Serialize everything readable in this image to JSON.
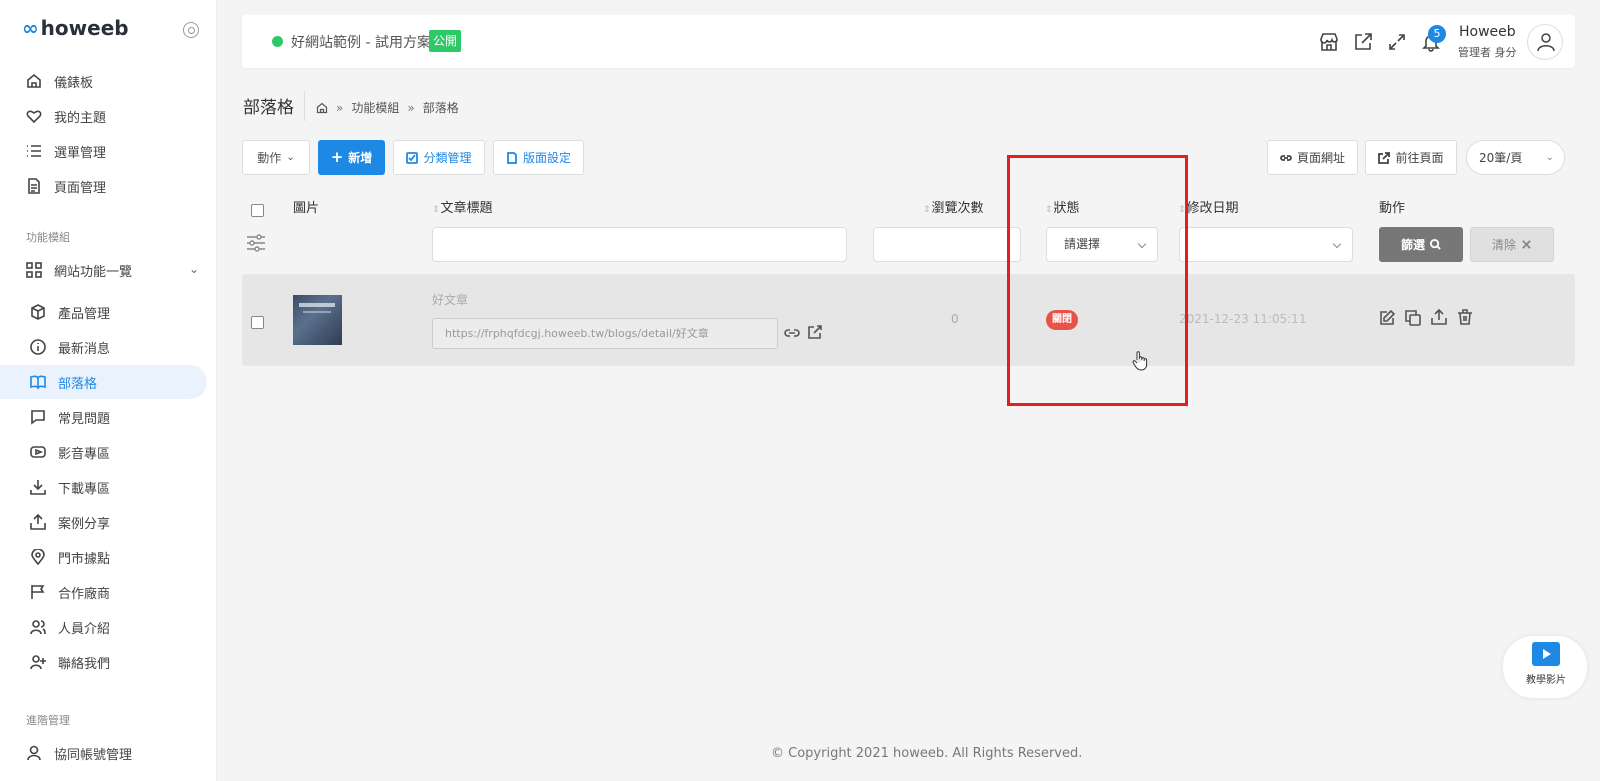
{
  "brand": {
    "logo_mark": "∞",
    "logo_text": "howeeb"
  },
  "sidebar": {
    "items": [
      {
        "label": "儀錶板",
        "icon": "home-icon"
      },
      {
        "label": "我的主題",
        "icon": "heart-icon"
      },
      {
        "label": "選單管理",
        "icon": "list-icon"
      },
      {
        "label": "頁面管理",
        "icon": "file-icon"
      }
    ],
    "section_modules": "功能模組",
    "group_label": "網站功能一覽",
    "sub_items": [
      {
        "label": "產品管理",
        "icon": "box-icon"
      },
      {
        "label": "最新消息",
        "icon": "info-icon"
      },
      {
        "label": "部落格",
        "icon": "book-icon",
        "active": true
      },
      {
        "label": "常見問題",
        "icon": "message-icon"
      },
      {
        "label": "影音專區",
        "icon": "video-icon"
      },
      {
        "label": "下載專區",
        "icon": "download-icon"
      },
      {
        "label": "案例分享",
        "icon": "share-icon"
      },
      {
        "label": "門市據點",
        "icon": "map-pin-icon"
      },
      {
        "label": "合作廠商",
        "icon": "flag-icon"
      },
      {
        "label": "人員介紹",
        "icon": "users-icon"
      },
      {
        "label": "聯絡我們",
        "icon": "user-plus-icon"
      }
    ],
    "section_admin": "進階管理",
    "admin_items": [
      {
        "label": "協同帳號管理",
        "icon": "user-icon"
      }
    ]
  },
  "topbar": {
    "site_name": "好網站範例 - 試用方案",
    "site_badge": "公開",
    "notification_count": "5",
    "user_name": "Howeeb",
    "user_role": "管理者 身分"
  },
  "page": {
    "title": "部落格",
    "breadcrumb": [
      "功能模組",
      "部落格"
    ]
  },
  "toolbar": {
    "action_label": "動作",
    "add_label": "新增",
    "category_label": "分類管理",
    "layout_label": "版面設定",
    "page_url_label": "頁面網址",
    "goto_page_label": "前往頁面",
    "per_page_label": "20筆/頁"
  },
  "table": {
    "columns": {
      "image": "圖片",
      "title": "文章標題",
      "views": "瀏覽次數",
      "status": "狀態",
      "modified": "修改日期",
      "action": "動作"
    },
    "filters": {
      "status_placeholder": "請選擇",
      "filter_label": "篩選",
      "clear_label": "清除"
    },
    "rows": [
      {
        "title": "好文章",
        "url": "https://frphqfdcgj.howeeb.tw/blogs/detail/好文章",
        "views": "0",
        "status": "關閉",
        "modified": "2021-12-23 11:05:11"
      }
    ]
  },
  "footer": {
    "copyright": "© Copyright 2021 howeeb. All Rights Reserved."
  },
  "tutorial": {
    "label": "教學影片"
  },
  "colors": {
    "accent": "#1e88e5",
    "success": "#2ec866",
    "danger": "#e5534b",
    "highlight": "#e02020"
  }
}
